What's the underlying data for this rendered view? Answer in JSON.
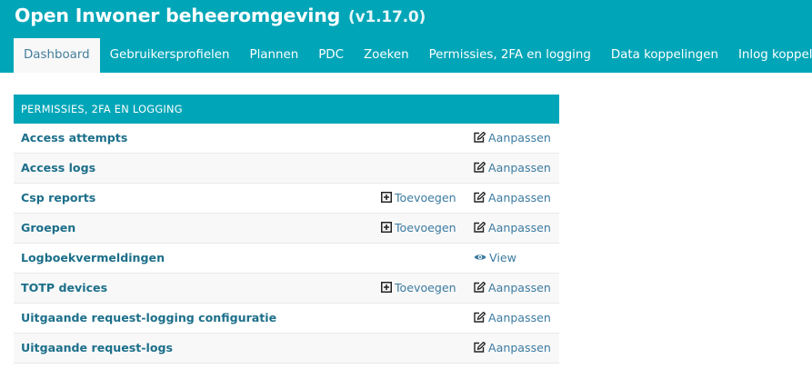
{
  "header": {
    "title": "Open Inwoner beheeromgeving",
    "version": "(v1.17.0)"
  },
  "nav": {
    "tabs": [
      {
        "label": "Dashboard",
        "active": true
      },
      {
        "label": "Gebruikersprofielen",
        "active": false
      },
      {
        "label": "Plannen",
        "active": false
      },
      {
        "label": "PDC",
        "active": false
      },
      {
        "label": "Zoeken",
        "active": false
      },
      {
        "label": "Permissies, 2FA en logging",
        "active": false
      },
      {
        "label": "Data koppelingen",
        "active": false
      },
      {
        "label": "Inlog koppelingen",
        "active": false
      }
    ]
  },
  "module": {
    "caption": "PERMISSIES, 2FA EN LOGGING",
    "add_label": "Toevoegen",
    "change_label": "Aanpassen",
    "view_label": "View",
    "rows": [
      {
        "name": "Access attempts",
        "add": false,
        "action": "change"
      },
      {
        "name": "Access logs",
        "add": false,
        "action": "change"
      },
      {
        "name": "Csp reports",
        "add": true,
        "action": "change"
      },
      {
        "name": "Groepen",
        "add": true,
        "action": "change"
      },
      {
        "name": "Logboekvermeldingen",
        "add": false,
        "action": "view"
      },
      {
        "name": "TOTP devices",
        "add": true,
        "action": "change"
      },
      {
        "name": "Uitgaande request-logging configuratie",
        "add": false,
        "action": "change"
      },
      {
        "name": "Uitgaande request-logs",
        "add": false,
        "action": "change"
      }
    ]
  },
  "colors": {
    "header_bg": "#00a6b8",
    "link": "#3c7ba1",
    "model_name": "#1c6f8a"
  }
}
